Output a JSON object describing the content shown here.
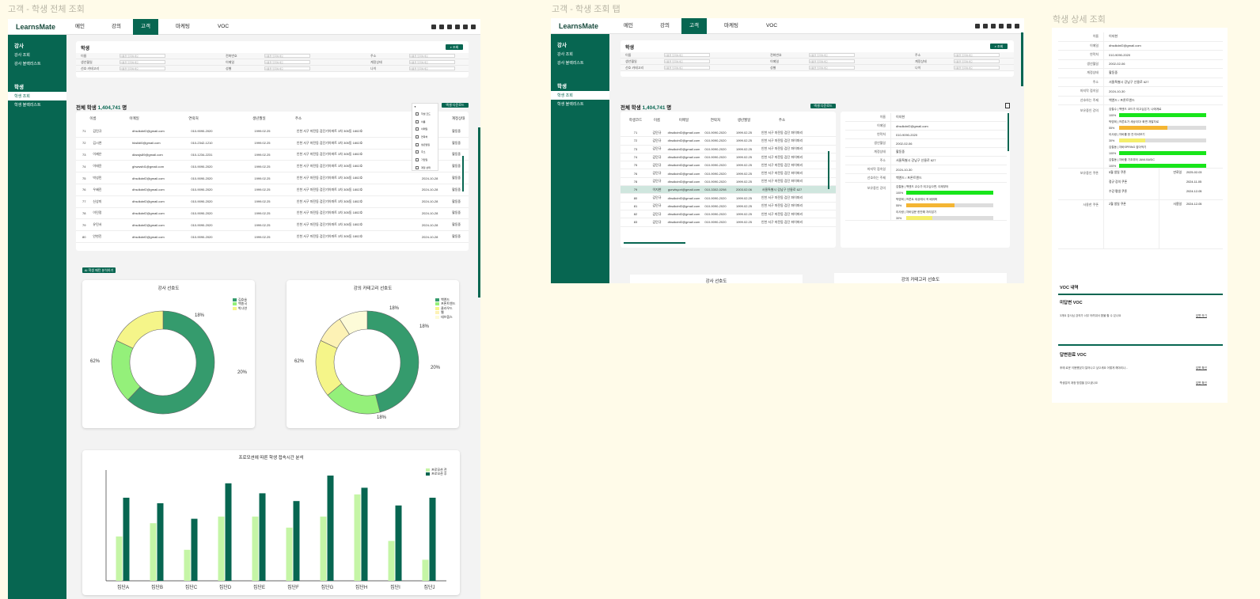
{
  "frame_labels": {
    "f1": "고객 - 학생 전체 조회",
    "f2": "고객 - 학생 조회 탭",
    "f3": "학생 상세 조회"
  },
  "app": {
    "logo": "LearnsMate",
    "nav": [
      "메인",
      "강의",
      "고객",
      "마케팅",
      "VOC"
    ],
    "active_nav": "고객"
  },
  "sidebar": {
    "sections": [
      {
        "title": "강사",
        "items": [
          "강사 조회",
          "강사 블랙리스트"
        ]
      },
      {
        "title": "학생",
        "items": [
          "학생 조회",
          "학생 블랙리스트"
        ]
      }
    ],
    "active_item": "학생 조회"
  },
  "filter": {
    "title": "학생",
    "search_button": "조회",
    "fields": [
      [
        "이름",
        "전화번호",
        "주소"
      ],
      [
        "생년월일",
        "이메일",
        "계정상태"
      ],
      [
        "선호 카테고리",
        "성별",
        "나이"
      ]
    ],
    "placeholder": "이름을 입력하세요"
  },
  "total": {
    "prefix": "전체 학생",
    "count": "1,404,741",
    "suffix": "명"
  },
  "excel_button": "엑셀 다운로드",
  "ai_button": "AI 학생 패턴 분석하기",
  "columns_f1": [
    "이름",
    "이메일",
    "연락처",
    "생년월일",
    "주소",
    "",
    "계정상태"
  ],
  "columns_f2": [
    "학생코드",
    "이름",
    "이메일",
    "연락처",
    "생년월일",
    "주소"
  ],
  "rows_f1": [
    [
      "71",
      "김민규",
      "dhsdkdnf2@gmail.com",
      "010-9090-2020",
      "1999.02.25",
      "인천 서구 마전동 검단기아파트 3차 305동 1802호",
      "",
      "활동중"
    ],
    [
      "72",
      "김시연",
      "hkslldi0@gmail.com",
      "010-2342-1210",
      "1999.02.25",
      "인천 서구 마전동 검단기아파트 3차 305동 1802호",
      "",
      "활동중"
    ],
    [
      "73",
      "이제은",
      "dkswjs89@gmail.com",
      "010-1234-2231",
      "1999.02.25",
      "인천 서구 마전동 검단기아파트 3차 305동 1802호",
      "",
      "활동중"
    ],
    [
      "74",
      "이태윤",
      "ghwwsfd1@gmail.com",
      "010-9090-2020",
      "1999.02.25",
      "인천 서구 마전동 검단기아파트 3차 305동 1802호",
      "",
      "활동중"
    ],
    [
      "75",
      "박성민",
      "dhsdkdnf2@gmail.com",
      "010-9090-2020",
      "1999.02.25",
      "인천 서구 마전동 검단기아파트 3차 305동 1802호",
      "2024-10-28",
      "활동중"
    ],
    [
      "76",
      "우혜진",
      "dhsdkdnf2@gmail.com",
      "010-9090-2020",
      "1999.02.25",
      "인천 서구 마전동 검단기아파트 3차 305동 1802호",
      "2024-10-28",
      "활동중"
    ],
    [
      "77",
      "신상미",
      "dhsdkdnf2@gmail.com",
      "010-9090-2020",
      "1999.02.25",
      "인천 서구 마전동 검단기아파트 3차 305동 1802호",
      "2024-10-28",
      "활동중"
    ],
    [
      "78",
      "이민정",
      "dhsdkdnf2@gmail.com",
      "010-9090-2020",
      "1999.02.25",
      "인천 서구 마전동 검단기아파트 3차 305동 1802호",
      "2024-10-28",
      "활동중"
    ],
    [
      "79",
      "유민서",
      "dhsdkdnf2@gmail.com",
      "010-9090-2020",
      "1999.02.25",
      "인천 서구 마전동 검단기아파트 3차 305동 1802호",
      "2024-10-28",
      "활동중"
    ],
    [
      "80",
      "안현진",
      "dhsdkdnf2@gmail.com",
      "010-9090-2020",
      "1999.02.25",
      "인천 서구 마전동 검단기아파트 3차 305동 1802호",
      "2024-10-28",
      "활동중"
    ]
  ],
  "dropdown_f1": [
    "학생 코드",
    "이름",
    "이메일",
    "연락처",
    "생년월일",
    "주소",
    "가입일",
    "계정 상태"
  ],
  "rows_f2": [
    [
      "71",
      "김민규",
      "dhsdkdnf2@gmail.com",
      "010-9090-2020",
      "1999.02.25",
      "인천 서구 마전동 검단 파이파리"
    ],
    [
      "72",
      "김민규",
      "dhsdkdnf2@gmail.com",
      "010-9090-2020",
      "1999.02.25",
      "인천 서구 마전동 검단 파이파리"
    ],
    [
      "73",
      "김민규",
      "dhsdkdnf2@gmail.com",
      "010-9090-2020",
      "1999.02.25",
      "인천 서구 마전동 검단 파이파리"
    ],
    [
      "74",
      "김민규",
      "dhsdkdnf2@gmail.com",
      "010-9090-2020",
      "1999.02.25",
      "인천 서구 마전동 검단 파이파리"
    ],
    [
      "75",
      "김민규",
      "dhsdkdnf2@gmail.com",
      "010-9090-2020",
      "1999.02.25",
      "인천 서구 마전동 검단 파이파리"
    ],
    [
      "76",
      "김민규",
      "dhsdkdnf2@gmail.com",
      "010-9090-2020",
      "1999.02.25",
      "인천 서구 마전동 검단 파이파리"
    ],
    [
      "78",
      "김민규",
      "dhsdkdnf2@gmail.com",
      "010-9090-2020",
      "1999.02.25",
      "인천 서구 마전동 검단 파이파리"
    ],
    [
      "79",
      "이지현",
      "gurwlsyori@gmail.com",
      "010-3302-0298",
      "2003.02.06",
      "서울특별시 강남구 선릉로 627"
    ],
    [
      "80",
      "김민규",
      "dhsdkdnf2@gmail.com",
      "010-9090-2020",
      "1999.02.25",
      "인천 서구 마전동 검단 파이파리"
    ],
    [
      "81",
      "김민규",
      "dhsdkdnf2@gmail.com",
      "010-9090-2020",
      "1999.02.25",
      "인천 서구 마전동 검단 파이파리"
    ],
    [
      "82",
      "김민규",
      "dhsdkdnf2@gmail.com",
      "010-9090-2020",
      "1999.02.25",
      "인천 서구 마전동 검단 파이파리"
    ],
    [
      "83",
      "김민규",
      "dhsdkdnf2@gmail.com",
      "010-9090-2020",
      "1999.02.25",
      "인천 서구 마전동 검단 파이파리"
    ]
  ],
  "selected_row_index": 7,
  "detail": {
    "fields": [
      [
        "이름",
        "이지현"
      ],
      [
        "이메일",
        "dhsdkdnf2@gmail.com"
      ],
      [
        "연락처",
        "010-9090-2020"
      ],
      [
        "생년월일",
        "2002-02-06"
      ],
      [
        "계정상태",
        "활동중"
      ],
      [
        "주소",
        "서울특별시 강남구 선릉로 627"
      ],
      [
        "마지막 접속일",
        "2024-10-30"
      ],
      [
        "선호하는 주제",
        "백엔드 / 프론트엔드"
      ]
    ],
    "courses_label": "보유중인 강의",
    "courses": [
      {
        "name": "김철수 | 백엔드 코드가 되고싶은가, 나에게로",
        "pct": 100,
        "pct_label": "100%",
        "color": "#18e51a"
      },
      {
        "name": "박영희 | 프론트가 세상이다! 화면 개발자로",
        "pct": 55,
        "pct_label": "55%",
        "color": "#f4b533"
      },
      {
        "name": "이사람 | 자바를 한 잔 마셔보기",
        "pct": 30,
        "pct_label": "30%",
        "color": "#f4ee6c"
      },
      {
        "name": "김철동 | 자바SPRING 잡아먹기",
        "pct": 100,
        "pct_label": "100%",
        "color": "#18e51a"
      },
      {
        "name": "김철동 | 자바를 기초부터 JAVA BASIC",
        "pct": 100,
        "pct_label": "100%",
        "color": "#18e51a"
      }
    ],
    "f2_courses": [
      {
        "name": "김철동 | 백엔드 교수가 되고싶으면, 이제부터",
        "pct": 100,
        "pct_label": "100%",
        "color": "#18e51a"
      },
      {
        "name": "박영희 | 프론트 세상에서 꼭 배워봐",
        "pct": 55,
        "pct_label": "55%",
        "color": "#f4b533"
      },
      {
        "name": "이사람 | 자바입문 한잔해 자리잡기",
        "pct": 30,
        "pct_label": "30%",
        "color": "#f4ee6c"
      }
    ],
    "coupons_label": "보유중인 쿠폰",
    "coupons": [
      [
        "5월 생일 쿠폰",
        "2025-02-03"
      ],
      [
        "정규 강의 쿠폰",
        "2024-11-05"
      ],
      [
        "수강 평생 쿠폰",
        "2024-12-05"
      ]
    ],
    "coupon_col": "만료일",
    "used_label": "사용한 쿠폰",
    "used": [
      [
        "2월 생일 쿠폰",
        "2024-12-05"
      ]
    ],
    "used_col": "사용일",
    "voc_title": "VOC 내역",
    "voc_pending_title": "미답변 VOC",
    "voc_pending": [
      {
        "text": "3개요 강사님 강의가 너무 어려워서 환불 할 수 있나요",
        "link": "답변 하기"
      }
    ],
    "voc_done_title": "답변완료 VOC",
    "voc_done": [
      {
        "text": "후에 로운 이용했었다 일어나고 싶으세요 어떻게 해야되나...",
        "link": "답변 확인"
      },
      {
        "text": "학생분의 계정 방법을 있으셨나요",
        "link": "답변 확인"
      }
    ]
  },
  "tabs_f2": [
    "강사 선호도",
    "강의 카테고리 선호도"
  ],
  "charts": [
    {
      "type": "donut",
      "title": "강사 선호도",
      "series": [
        {
          "name": "김효슬",
          "value": 62,
          "label": "62%",
          "color": "#359b6d"
        },
        {
          "name": "백종국",
          "value": 20,
          "label": "20%",
          "color": "#94f07a"
        },
        {
          "name": "박나연",
          "value": 18,
          "label": "18%",
          "color": "#f5f589"
        }
      ]
    },
    {
      "type": "donut",
      "title": "강의 카테고리 선호도",
      "series": [
        {
          "name": "백엔드",
          "value": 46,
          "label": "62%",
          "color": "#359b6d"
        },
        {
          "name": "프론트엔드",
          "value": 18,
          "label": "18%",
          "color": "#94f07a"
        },
        {
          "name": "클라우드",
          "value": 18,
          "label": "20%",
          "color": "#f5f589"
        },
        {
          "name": "웹",
          "value": 9,
          "label": "18%",
          "color": "#fdf2b5"
        },
        {
          "name": "데브옵스",
          "value": 9,
          "label": "18%",
          "color": "#fdfbd8"
        }
      ]
    },
    {
      "type": "bar",
      "title": "프로모션에 따른 학생 접속시간 분석",
      "categories": [
        "집단A",
        "집단B",
        "집단C",
        "집단D",
        "집단E",
        "집단F",
        "집단G",
        "집단H",
        "집단I",
        "집단J"
      ],
      "series": [
        {
          "name": "프로모션 전",
          "values": [
            40,
            52,
            28,
            58,
            58,
            48,
            58,
            78,
            36,
            19
          ],
          "color": "#c5f5a6"
        },
        {
          "name": "프로모션 후",
          "values": [
            75,
            70,
            56,
            88,
            79,
            72,
            95,
            84,
            68,
            75
          ],
          "color": "#076651"
        }
      ],
      "ylim": [
        0,
        100
      ]
    }
  ],
  "chart_data": [
    {
      "type": "pie",
      "title": "강사 선호도",
      "categories": [
        "김효슬",
        "백종국",
        "박나연"
      ],
      "values": [
        62,
        20,
        18
      ]
    },
    {
      "type": "pie",
      "title": "강의 카테고리 선호도",
      "categories": [
        "백엔드",
        "프론트엔드",
        "클라우드",
        "웹",
        "데브옵스"
      ],
      "values": [
        62,
        18,
        20,
        18,
        18
      ]
    },
    {
      "type": "bar",
      "title": "프로모션에 따른 학생 접속시간 분석",
      "categories": [
        "집단A",
        "집단B",
        "집단C",
        "집단D",
        "집단E",
        "집단F",
        "집단G",
        "집단H",
        "집단I",
        "집단J"
      ],
      "series": [
        {
          "name": "프로모션 전",
          "values": [
            40,
            52,
            28,
            58,
            58,
            48,
            58,
            78,
            36,
            19
          ]
        },
        {
          "name": "프로모션 후",
          "values": [
            75,
            70,
            56,
            88,
            79,
            72,
            95,
            84,
            68,
            75
          ]
        }
      ],
      "ylim": [
        0,
        100
      ]
    }
  ]
}
